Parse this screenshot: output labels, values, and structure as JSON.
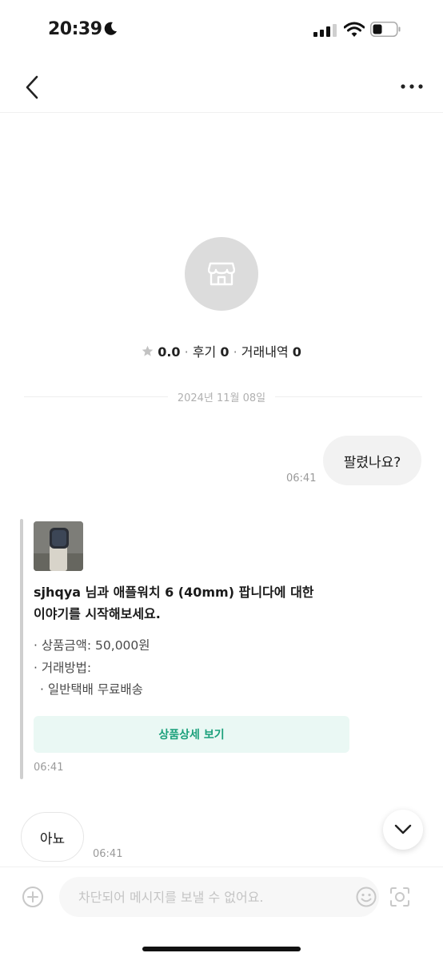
{
  "status_bar": {
    "time": "20:39"
  },
  "profile": {
    "rating": "0.0",
    "reviews_label": "후기",
    "reviews_count": "0",
    "trades_label": "거래내역",
    "trades_count": "0"
  },
  "chat": {
    "date": "2024년 11월 08일",
    "message_1": {
      "text": "팔렸나요?",
      "time": "06:41"
    },
    "product_card": {
      "title_line_1": "sjhqya 님과 애플워치 6 (40mm) 팝니다에 대한",
      "title_line_2": "이야기를 시작해보세요.",
      "price_line": "· 상품금액: 50,000원",
      "method_label": "· 거래방법:",
      "method_value": "· 일반택배 무료배송",
      "detail_button": "상품상세 보기",
      "time": "06:41"
    },
    "message_2": {
      "text": "아뇨",
      "time": "06:41"
    }
  },
  "input": {
    "placeholder": "차단되어 메시지를 보낼 수 없어요."
  },
  "icons": {
    "back": "chevron-left-icon",
    "more": "more-dots-icon",
    "store": "store-icon",
    "star": "star-icon",
    "scroll_down": "chevron-down-icon",
    "plus": "plus-circle-icon",
    "emoji": "emoji-icon",
    "camera": "camera-scan-icon"
  },
  "colors": {
    "accent_green": "#1ba07b",
    "detail_button_bg": "#eaf8f4",
    "bubble_gray": "#f2f2f2"
  }
}
